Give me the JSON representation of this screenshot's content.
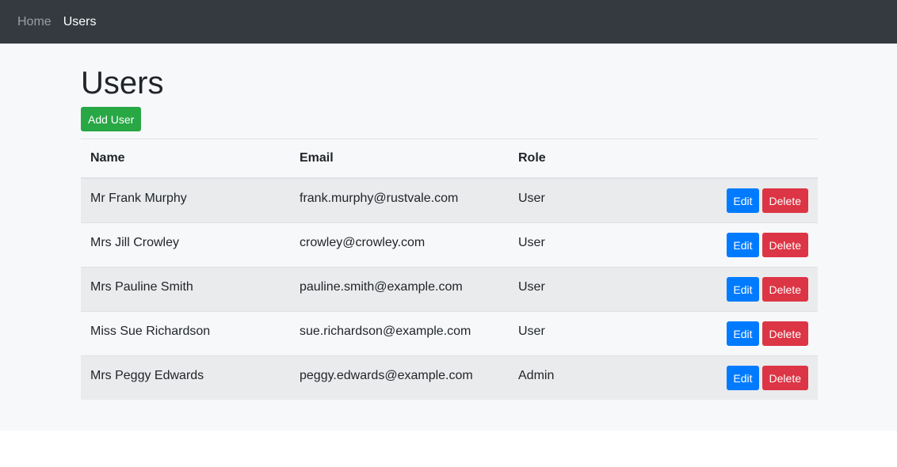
{
  "nav": {
    "items": [
      {
        "label": "Home",
        "active": false
      },
      {
        "label": "Users",
        "active": true
      }
    ]
  },
  "page": {
    "title": "Users",
    "add_button_label": "Add User"
  },
  "table": {
    "columns": [
      "Name",
      "Email",
      "Role",
      ""
    ],
    "rows": [
      {
        "name": "Mr Frank Murphy",
        "email": "frank.murphy@rustvale.com",
        "role": "User"
      },
      {
        "name": "Mrs Jill Crowley",
        "email": "crowley@crowley.com",
        "role": "User"
      },
      {
        "name": "Mrs Pauline Smith",
        "email": "pauline.smith@example.com",
        "role": "User"
      },
      {
        "name": "Miss Sue Richardson",
        "email": "sue.richardson@example.com",
        "role": "User"
      },
      {
        "name": "Mrs Peggy Edwards",
        "email": "peggy.edwards@example.com",
        "role": "Admin"
      }
    ],
    "edit_label": "Edit",
    "delete_label": "Delete"
  },
  "colors": {
    "navbar": "#343a40",
    "add": "#28a745",
    "edit": "#007bff",
    "delete": "#dc3545"
  }
}
